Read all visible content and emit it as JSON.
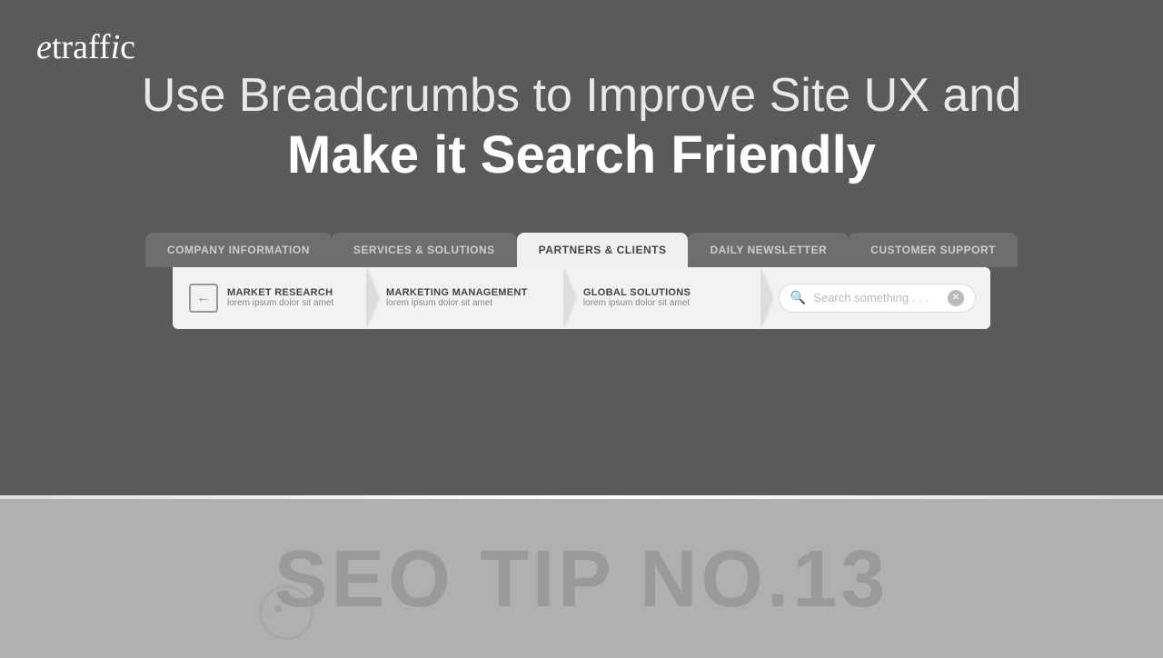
{
  "logo": {
    "text": "etraffic"
  },
  "headline": {
    "line1": "Use Breadcrumbs to Improve Site UX and",
    "line2": "Make it Search Friendly"
  },
  "nav": {
    "tabs": [
      {
        "label": "COMPANY INFORMATION",
        "active": false
      },
      {
        "label": "SERVICES & SOLUTIONS",
        "active": false
      },
      {
        "label": "PARTNERS & CLIENTS",
        "active": true
      },
      {
        "label": "DAILY NEWSLETTER",
        "active": false
      },
      {
        "label": "CUSTOMER SUPPORT",
        "active": false
      }
    ]
  },
  "breadcrumbs": {
    "items": [
      {
        "title": "MARKET RESEARCH",
        "subtitle": "lorem ipsum dolor sit amet"
      },
      {
        "title": "MARKETING MANAGEMENT",
        "subtitle": "lorem ipsum dolor sit amet"
      },
      {
        "title": "GLOBAL SOLUTIONS",
        "subtitle": "lorem ipsum dolor sit amet"
      }
    ],
    "search": {
      "placeholder": "Search something . . ."
    }
  },
  "seo_tip": {
    "text": "SEO TIP NO.13"
  }
}
